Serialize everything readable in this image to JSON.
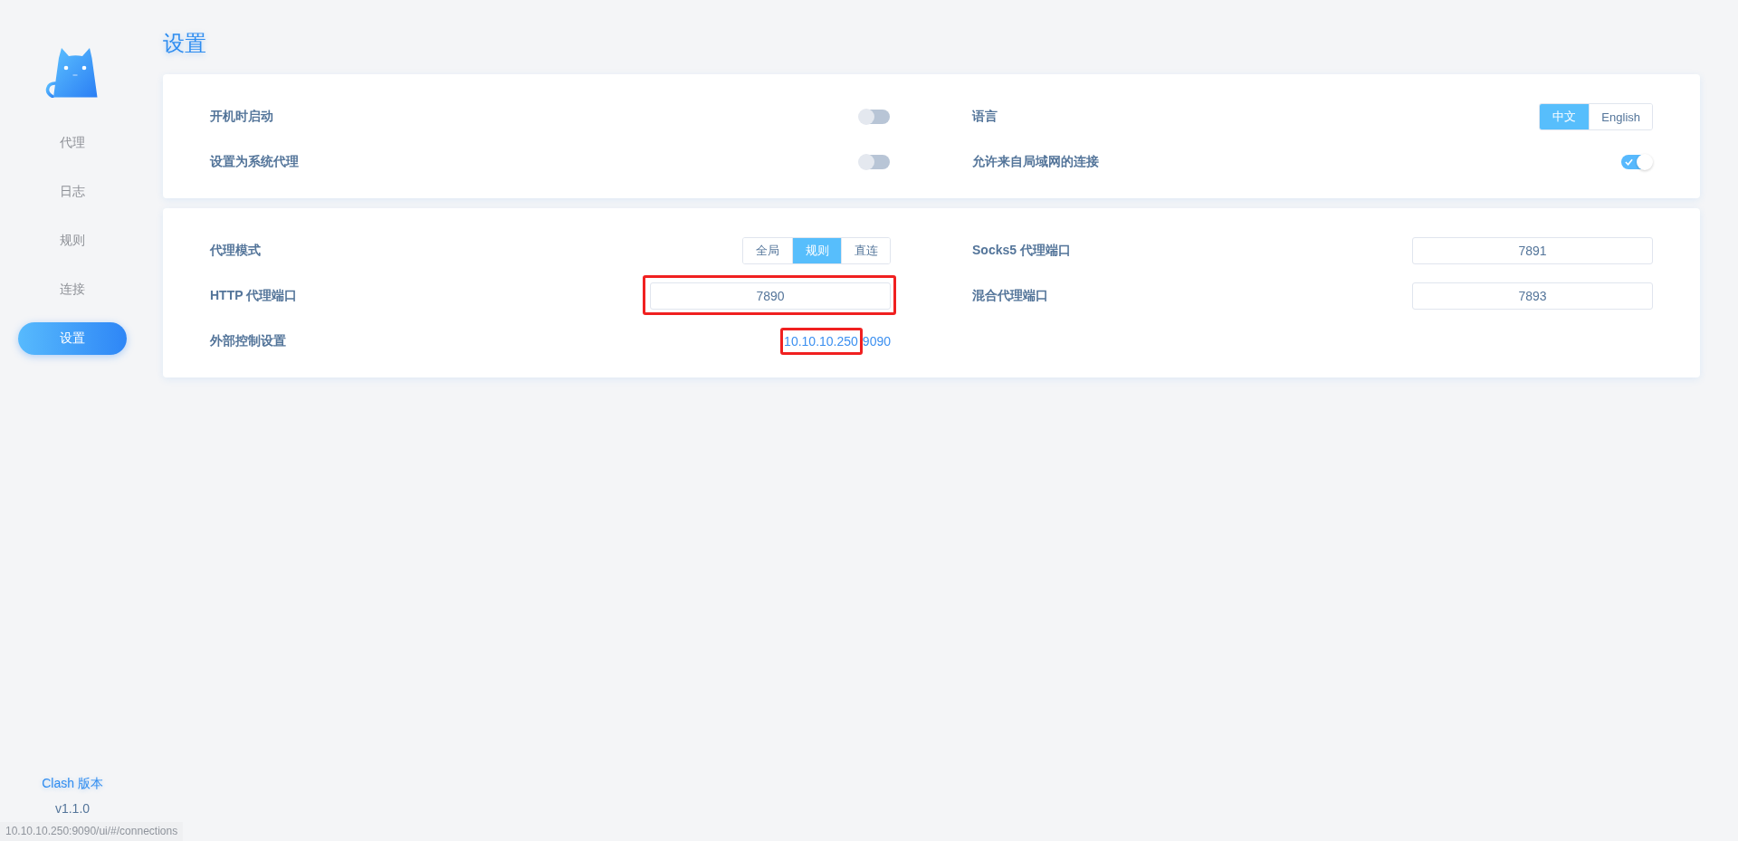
{
  "sidebar": {
    "items": [
      {
        "label": "代理",
        "selected": false
      },
      {
        "label": "日志",
        "selected": false
      },
      {
        "label": "规则",
        "selected": false
      },
      {
        "label": "连接",
        "selected": false
      },
      {
        "label": "设置",
        "selected": true
      }
    ],
    "version_label": "Clash 版本",
    "version": "v1.1.0"
  },
  "page": {
    "title": "设置"
  },
  "cards": [
    {
      "left": [
        {
          "kind": "switch",
          "label": "开机时启动",
          "on": false,
          "highlighted": false
        },
        {
          "kind": "switch",
          "label": "设置为系统代理",
          "on": false,
          "highlighted": false
        }
      ],
      "right": [
        {
          "kind": "segmented",
          "label": "语言",
          "options": [
            {
              "label": "中文",
              "selected": true
            },
            {
              "label": "English",
              "selected": false
            }
          ],
          "highlighted": false
        },
        {
          "kind": "switch",
          "label": "允许来自局域网的连接",
          "on": true,
          "highlighted": false
        }
      ]
    },
    {
      "left": [
        {
          "kind": "segmented",
          "label": "代理模式",
          "options": [
            {
              "label": "全局",
              "selected": false
            },
            {
              "label": "规则",
              "selected": true
            },
            {
              "label": "直连",
              "selected": false
            }
          ],
          "highlighted": false
        },
        {
          "kind": "input",
          "label": "HTTP 代理端口",
          "value": "7890",
          "highlighted": true
        },
        {
          "kind": "link",
          "label": "外部控制设置",
          "value_parts": [
            "10.10.10.250",
            "9090"
          ],
          "highlighted": true
        }
      ],
      "right": [
        {
          "kind": "input",
          "label": "Socks5 代理端口",
          "value": "7891",
          "highlighted": false
        },
        {
          "kind": "input",
          "label": "混合代理端口",
          "value": "7893",
          "highlighted": false
        }
      ]
    }
  ],
  "browser_status": "10.10.10.250:9090/ui/#/connections"
}
